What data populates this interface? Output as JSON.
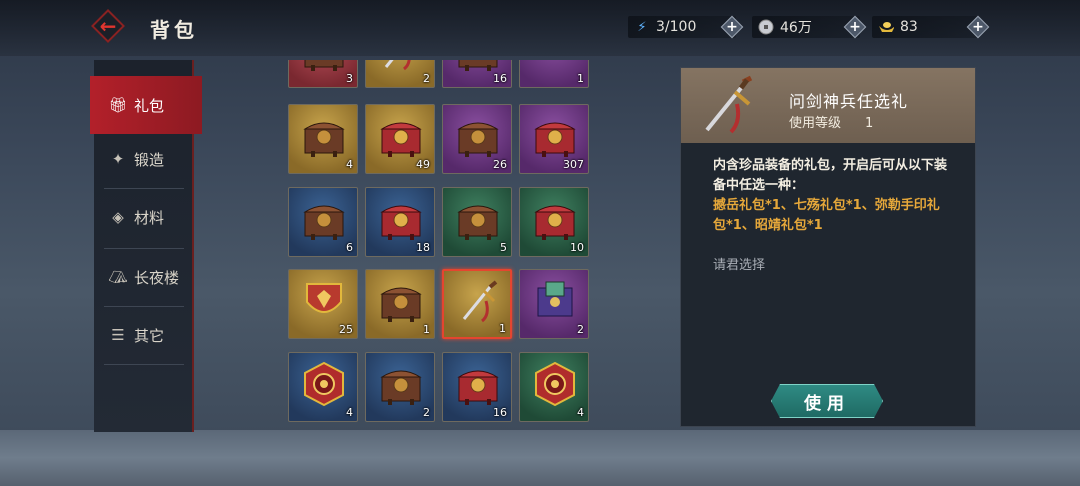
{
  "header": {
    "title": "背包",
    "resources": [
      {
        "icon": "lightning-icon",
        "value": "3/100"
      },
      {
        "icon": "coin-icon",
        "value": "46万"
      },
      {
        "icon": "gold-ingot-icon",
        "value": "83"
      }
    ]
  },
  "sidebar": {
    "items": [
      {
        "label": "礼包",
        "icon": "gift-icon",
        "active": true
      },
      {
        "label": "锻造",
        "icon": "forge-icon",
        "active": false
      },
      {
        "label": "材料",
        "icon": "material-icon",
        "active": false
      },
      {
        "label": "长夜楼",
        "icon": "tower-icon",
        "active": false
      },
      {
        "label": "其它",
        "icon": "list-icon",
        "active": false
      }
    ]
  },
  "inventory": {
    "rows": [
      [
        {
          "count": "3",
          "rarity": "red",
          "item": "chest"
        },
        {
          "count": "2",
          "rarity": "gold",
          "item": "sword"
        },
        {
          "count": "16",
          "rarity": "purple",
          "item": "chest"
        },
        {
          "count": "1",
          "rarity": "purple",
          "item": "blade"
        }
      ],
      [
        {
          "count": "4",
          "rarity": "gold",
          "item": "chest"
        },
        {
          "count": "49",
          "rarity": "gold",
          "item": "red-chest"
        },
        {
          "count": "26",
          "rarity": "purple",
          "item": "chest"
        },
        {
          "count": "307",
          "rarity": "purple",
          "item": "red-chest"
        }
      ],
      [
        {
          "count": "6",
          "rarity": "blue",
          "item": "chest"
        },
        {
          "count": "18",
          "rarity": "blue",
          "item": "red-chest"
        },
        {
          "count": "5",
          "rarity": "green",
          "item": "chest"
        },
        {
          "count": "10",
          "rarity": "green",
          "item": "red-chest"
        }
      ],
      [
        {
          "count": "25",
          "rarity": "gold",
          "item": "shield"
        },
        {
          "count": "1",
          "rarity": "gold",
          "item": "chest"
        },
        {
          "count": "1",
          "rarity": "gold",
          "item": "sword",
          "selected": true
        },
        {
          "count": "2",
          "rarity": "purple",
          "item": "box"
        }
      ],
      [
        {
          "count": "4",
          "rarity": "blue",
          "item": "round-box"
        },
        {
          "count": "2",
          "rarity": "blue",
          "item": "chest"
        },
        {
          "count": "16",
          "rarity": "blue",
          "item": "red-chest"
        },
        {
          "count": "4",
          "rarity": "green",
          "item": "round-box"
        }
      ]
    ]
  },
  "detail": {
    "name": "问剑神兵任选礼",
    "level_label": "使用等级",
    "level_value": "1",
    "description": "内含珍品装备的礼包，开启后可从以下装备中任选一种：",
    "items_text": "撼岳礼包*1、七殇礼包*1、弥勒手印礼包*1、昭靖礼包*1",
    "hint": "请君选择",
    "use_button": "使用"
  },
  "colors": {
    "accent_red": "#b3202a",
    "item_highlight": "#e6a83a",
    "button_teal": "#2f8b84"
  }
}
